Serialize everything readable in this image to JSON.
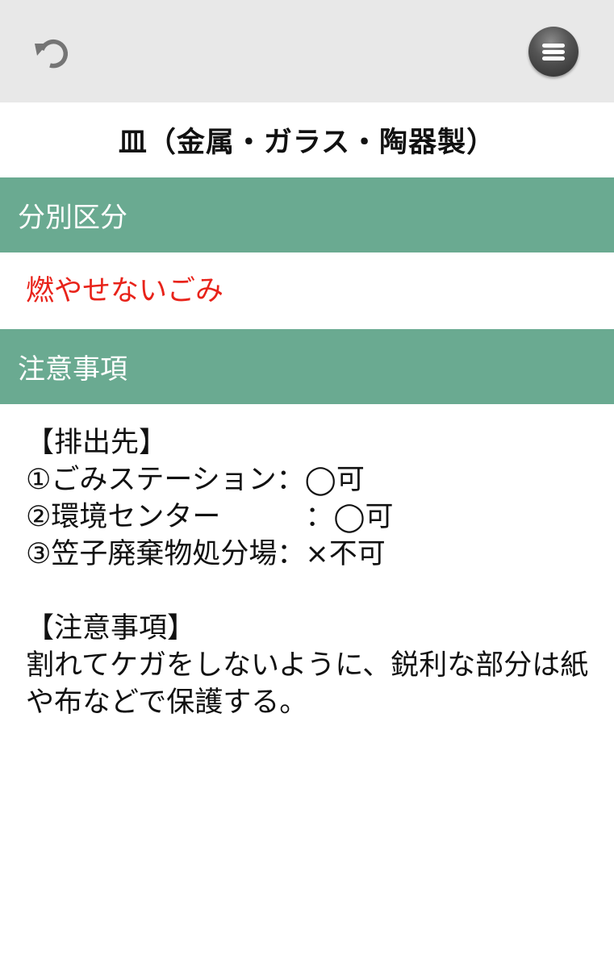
{
  "toolbar": {
    "back_icon": "undo-icon",
    "menu_icon": "hamburger-menu-icon"
  },
  "page": {
    "title": "皿（金属・ガラス・陶器製）"
  },
  "sections": {
    "category_header": "分別区分",
    "category_value": "燃やせないごみ",
    "notes_header": "注意事項"
  },
  "notes": {
    "destinations_heading": "【排出先】",
    "destinations": [
      "①ごみステーション：◯可",
      "②環境センター　　　：◯可",
      "③笠子廃棄物処分場：×不可"
    ],
    "cautions_heading": "【注意事項】",
    "cautions_text": "割れてケガをしないように、鋭利な部分は紙や布などで保護する。"
  },
  "colors": {
    "topbar_bg": "#e8e8e8",
    "section_header_bg": "#6aaa91",
    "category_text": "#e8231a"
  }
}
